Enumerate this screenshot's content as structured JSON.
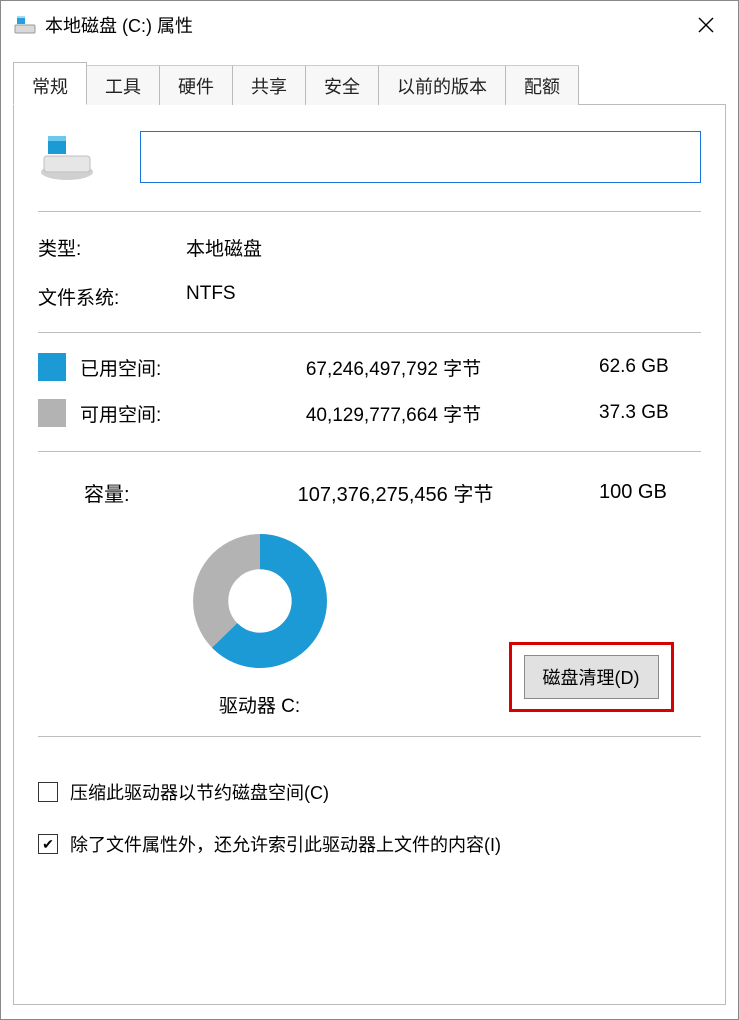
{
  "window": {
    "title": "本地磁盘 (C:) 属性"
  },
  "tabs": {
    "general": "常规",
    "tools": "工具",
    "hardware": "硬件",
    "sharing": "共享",
    "security": "安全",
    "previous": "以前的版本",
    "quota": "配额"
  },
  "general": {
    "name_value": "",
    "type_label": "类型:",
    "type_value": "本地磁盘",
    "filesystem_label": "文件系统:",
    "filesystem_value": "NTFS",
    "used_label": "已用空间:",
    "used_bytes": "67,246,497,792 字节",
    "used_gb": "62.6 GB",
    "free_label": "可用空间:",
    "free_bytes": "40,129,777,664 字节",
    "free_gb": "37.3 GB",
    "capacity_label": "容量:",
    "capacity_bytes": "107,376,275,456 字节",
    "capacity_gb": "100 GB",
    "drive_label": "驱动器 C:",
    "cleanup_button": "磁盘清理(D)",
    "compress_label": "压缩此驱动器以节约磁盘空间(C)",
    "compress_checked": false,
    "index_label": "除了文件属性外，还允许索引此驱动器上文件的内容(I)",
    "index_checked": true
  },
  "colors": {
    "used": "#1c9ad6",
    "free": "#b3b3b3",
    "accent_border": "#1a73d6",
    "highlight": "#d90000"
  },
  "chart_data": {
    "type": "pie",
    "title": "驱动器 C:",
    "categories": [
      "已用空间",
      "可用空间"
    ],
    "values": [
      62.6,
      37.3
    ],
    "series_colors": [
      "#1c9ad6",
      "#b3b3b3"
    ],
    "unit": "GB",
    "total": 100
  }
}
